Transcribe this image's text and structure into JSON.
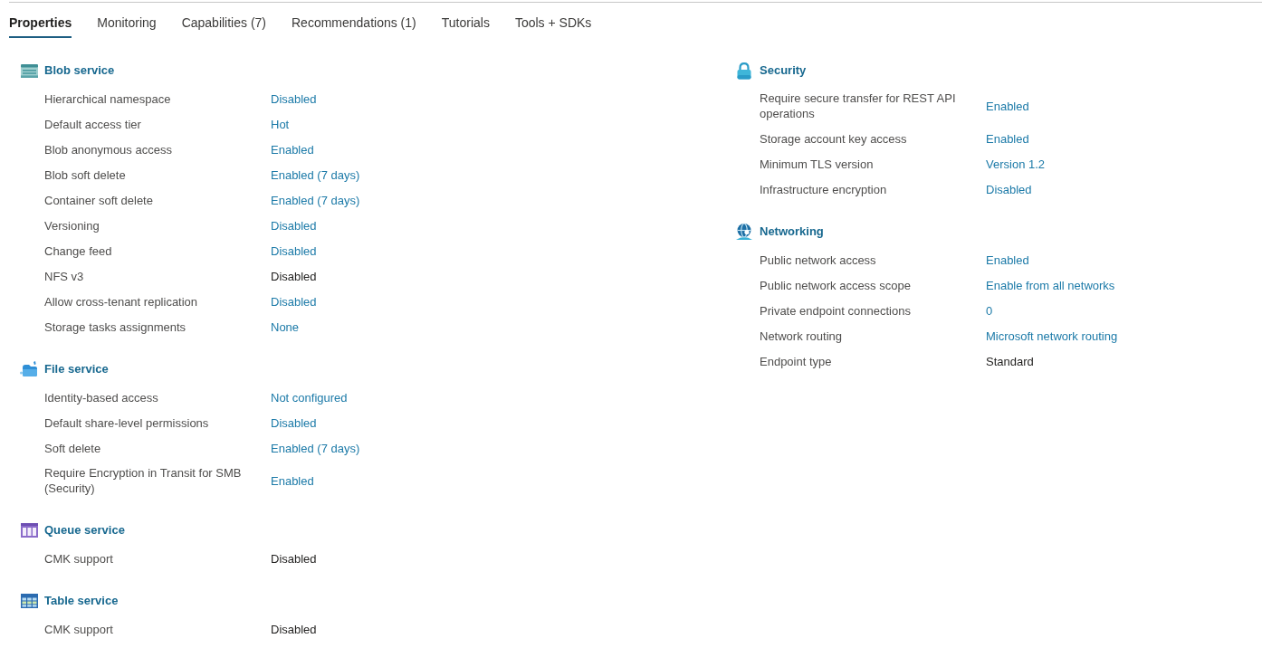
{
  "tabs": [
    {
      "label": "Properties",
      "selected": true
    },
    {
      "label": "Monitoring",
      "selected": false
    },
    {
      "label": "Capabilities (7)",
      "selected": false
    },
    {
      "label": "Recommendations (1)",
      "selected": false
    },
    {
      "label": "Tutorials",
      "selected": false
    },
    {
      "label": "Tools + SDKs",
      "selected": false
    }
  ],
  "columns": [
    {
      "sections": [
        {
          "title": "Blob service",
          "kind": "blob",
          "properties": [
            {
              "label": "Hierarchical namespace",
              "value": "Disabled",
              "kind": "link"
            },
            {
              "label": "Default access tier",
              "value": "Hot",
              "kind": "link"
            },
            {
              "label": "Blob anonymous access",
              "value": "Enabled",
              "kind": "link"
            },
            {
              "label": "Blob soft delete",
              "value": "Enabled (7 days)",
              "kind": "link"
            },
            {
              "label": "Container soft delete",
              "value": "Enabled (7 days)",
              "kind": "link"
            },
            {
              "label": "Versioning",
              "value": "Disabled",
              "kind": "link"
            },
            {
              "label": "Change feed",
              "value": "Disabled",
              "kind": "link"
            },
            {
              "label": "NFS v3",
              "value": "Disabled",
              "kind": "text"
            },
            {
              "label": "Allow cross-tenant replication",
              "value": "Disabled",
              "kind": "link"
            },
            {
              "label": "Storage tasks assignments",
              "value": "None",
              "kind": "link"
            }
          ]
        },
        {
          "title": "File service",
          "kind": "file",
          "properties": [
            {
              "label": "Identity-based access",
              "value": "Not configured",
              "kind": "link"
            },
            {
              "label": "Default share-level permissions",
              "value": "Disabled",
              "kind": "link"
            },
            {
              "label": "Soft delete",
              "value": "Enabled (7 days)",
              "kind": "link"
            },
            {
              "label": "Require Encryption in Transit for SMB (Security)",
              "value": "Enabled",
              "kind": "link"
            }
          ]
        },
        {
          "title": "Queue service",
          "kind": "queue",
          "properties": [
            {
              "label": "CMK support",
              "value": "Disabled",
              "kind": "text"
            }
          ]
        },
        {
          "title": "Table service",
          "kind": "table",
          "properties": [
            {
              "label": "CMK support",
              "value": "Disabled",
              "kind": "text"
            }
          ]
        }
      ]
    },
    {
      "sections": [
        {
          "title": "Security",
          "kind": "security",
          "properties": [
            {
              "label": "Require secure transfer for REST API operations",
              "value": "Enabled",
              "kind": "link"
            },
            {
              "label": "Storage account key access",
              "value": "Enabled",
              "kind": "link"
            },
            {
              "label": "Minimum TLS version",
              "value": "Version 1.2",
              "kind": "link"
            },
            {
              "label": "Infrastructure encryption",
              "value": "Disabled",
              "kind": "link"
            }
          ]
        },
        {
          "title": "Networking",
          "kind": "networking",
          "properties": [
            {
              "label": "Public network access",
              "value": "Enabled",
              "kind": "link"
            },
            {
              "label": "Public network access scope",
              "value": "Enable from all networks",
              "kind": "link"
            },
            {
              "label": "Private endpoint connections",
              "value": "0",
              "kind": "link"
            },
            {
              "label": "Network routing",
              "value": "Microsoft network routing",
              "kind": "link"
            },
            {
              "label": "Endpoint type",
              "value": "Standard",
              "kind": "text"
            }
          ]
        }
      ]
    }
  ]
}
